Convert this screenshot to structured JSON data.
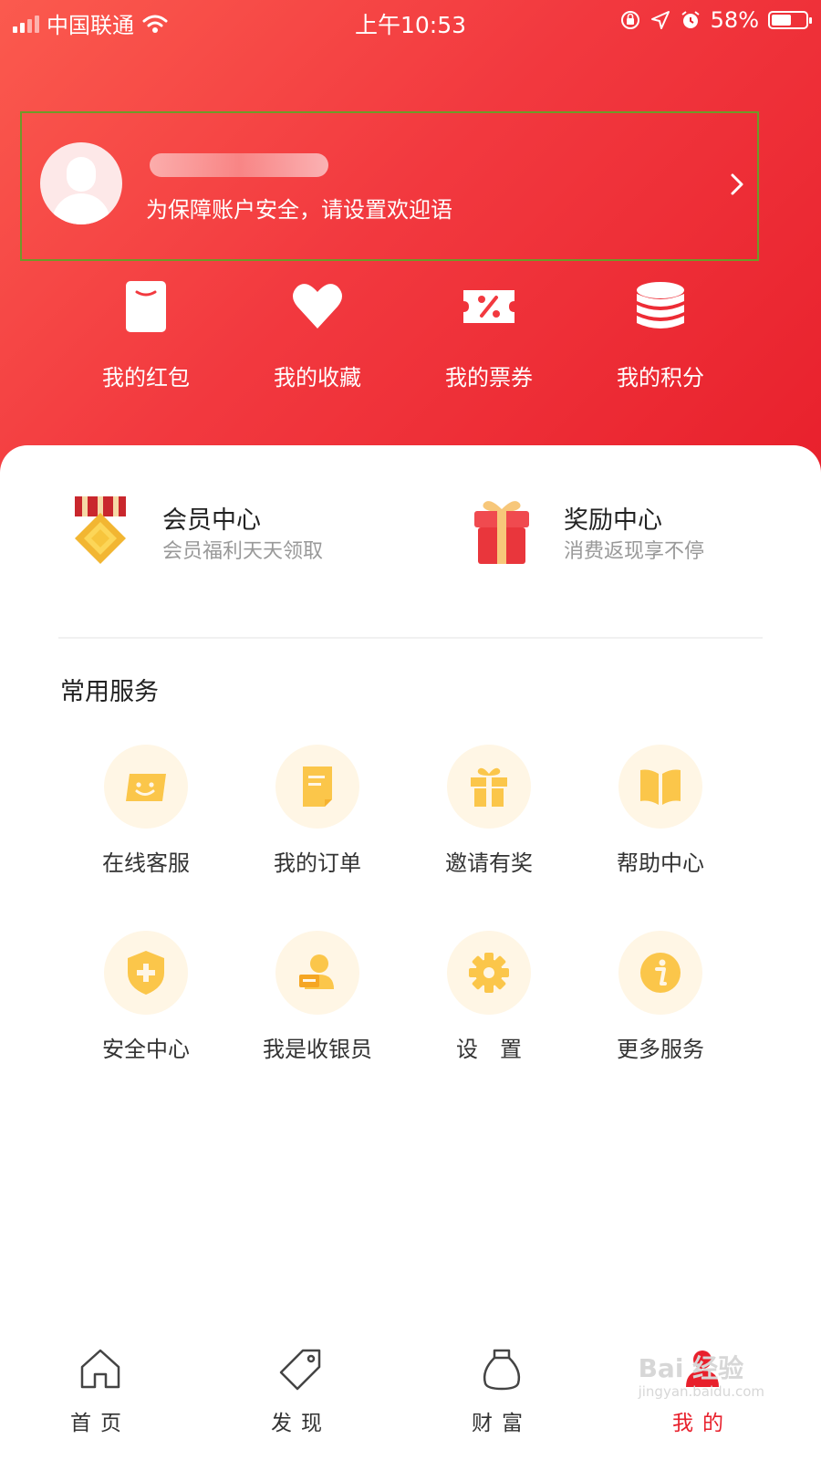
{
  "status_bar": {
    "carrier": "中国联通",
    "time": "上午10:53",
    "battery": "58%",
    "battery_level": 0.58
  },
  "profile": {
    "tagline": "为保障账户安全，请设置欢迎语"
  },
  "quick_actions": [
    {
      "label": "我的红包",
      "icon": "red-packet-icon"
    },
    {
      "label": "我的收藏",
      "icon": "heart-icon"
    },
    {
      "label": "我的票券",
      "icon": "coupon-icon"
    },
    {
      "label": "我的积分",
      "icon": "coins-icon"
    }
  ],
  "features": [
    {
      "title": "会员中心",
      "subtitle": "会员福利天天领取",
      "icon": "medal-icon"
    },
    {
      "title": "奖励中心",
      "subtitle": "消费返现享不停",
      "icon": "gift-box-icon"
    }
  ],
  "common_services": {
    "title": "常用服务",
    "items": [
      {
        "label": "在线客服",
        "icon": "chat-card-icon"
      },
      {
        "label": "我的订单",
        "icon": "order-doc-icon"
      },
      {
        "label": "邀请有奖",
        "icon": "gift-icon"
      },
      {
        "label": "帮助中心",
        "icon": "book-icon"
      },
      {
        "label": "安全中心",
        "icon": "shield-plus-icon"
      },
      {
        "label": "我是收银员",
        "icon": "cashier-icon"
      },
      {
        "label": "设　置",
        "icon": "gear-icon"
      },
      {
        "label": "更多服务",
        "icon": "info-icon"
      }
    ]
  },
  "tab_bar": [
    {
      "label": "首页",
      "icon": "home-icon"
    },
    {
      "label": "发现",
      "icon": "tag-icon"
    },
    {
      "label": "财富",
      "icon": "money-bag-icon"
    },
    {
      "label": "我的",
      "icon": "user-icon",
      "active": true
    }
  ],
  "watermark": {
    "brand": "Bai 经验",
    "url": "jingyan.baidu.com"
  },
  "colors": {
    "brand_red": "#e8202c",
    "service_accent": "#fbc64a",
    "service_bg": "#fff6e5"
  }
}
